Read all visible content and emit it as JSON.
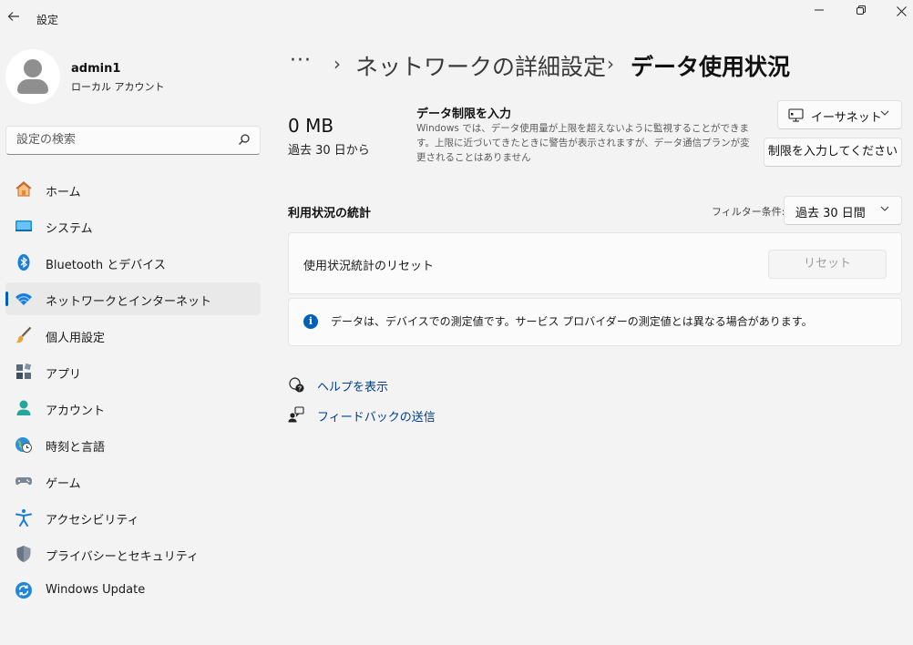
{
  "window": {
    "title": "設定",
    "back_icon": "back-arrow-icon",
    "minimize_glyph": "—",
    "maximize_glyph": "❐",
    "close_glyph": "✕"
  },
  "profile": {
    "name": "admin1",
    "account_type": "ローカル アカウント"
  },
  "search": {
    "placeholder": "設定の検索"
  },
  "sidebar": {
    "items": [
      {
        "label": "ホーム",
        "icon": "home-icon"
      },
      {
        "label": "システム",
        "icon": "system-icon"
      },
      {
        "label": "Bluetooth とデバイス",
        "icon": "bluetooth-icon"
      },
      {
        "label": "ネットワークとインターネット",
        "icon": "wifi-icon",
        "active": true
      },
      {
        "label": "個人用設定",
        "icon": "brush-icon"
      },
      {
        "label": "アプリ",
        "icon": "apps-icon"
      },
      {
        "label": "アカウント",
        "icon": "account-icon"
      },
      {
        "label": "時刻と言語",
        "icon": "globe-clock-icon"
      },
      {
        "label": "ゲーム",
        "icon": "gamepad-icon"
      },
      {
        "label": "アクセシビリティ",
        "icon": "accessibility-icon"
      },
      {
        "label": "プライバシーとセキュリティ",
        "icon": "shield-icon"
      },
      {
        "label": "Windows Update",
        "icon": "update-icon"
      }
    ]
  },
  "breadcrumb": {
    "more": "···",
    "separator": "›",
    "parent": "ネットワークの詳細設定",
    "current": "データ使用状況"
  },
  "usage": {
    "value": "0 MB",
    "period": "過去 30 日から"
  },
  "limit": {
    "title": "データ制限を入力",
    "description": "Windows では、データ使用量が上限を超えないように監視することができます。上限に近づいてきたときに警告が表示されますが、データ通信プランが変更されることはありません",
    "adapter": "イーサネット",
    "button": "制限を入力してください"
  },
  "stats": {
    "title": "利用状況の統計",
    "filter_label": "フィルター条件:",
    "filter_value": "過去 30 日間",
    "reset_label": "使用状況統計のリセット",
    "reset_button": "リセット",
    "info": "データは、デバイスでの測定値です。サービス プロバイダーの測定値とは異なる場合があります。"
  },
  "links": {
    "help": "ヘルプを表示",
    "feedback": "フィードバックの送信"
  },
  "colors": {
    "accent": "#005fb8",
    "link": "#003e92",
    "background": "#f3f3f3"
  }
}
